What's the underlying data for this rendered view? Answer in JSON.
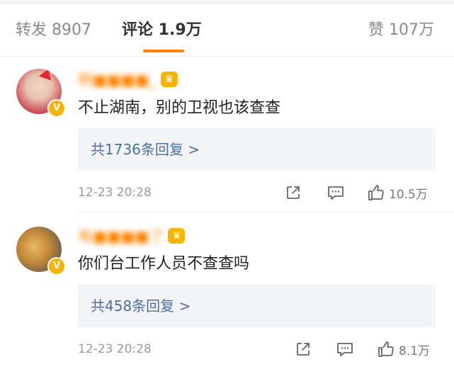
{
  "tabs": {
    "repost": "转发 8907",
    "comments": "评论 1.9万",
    "likes": "赞 107万"
  },
  "colors": {
    "accent": "#ff8200",
    "username": "#ff8200",
    "link": "#4d6e9e",
    "verified": "#f5b400"
  },
  "comments": [
    {
      "username": "杨■■■■_",
      "text": "不止湖南，别的卫视也该查查",
      "replies": "共1736条回复 >",
      "time": "12-23 20:28",
      "likes": "10.5万",
      "icons": [
        "avatar",
        "verified-icon",
        "crown-icon",
        "share-icon",
        "reply-icon",
        "like-icon"
      ]
    },
    {
      "username": "有■■■■了",
      "text": "你们台工作人员不查查吗",
      "replies": "共458条回复 >",
      "time": "12-23 20:28",
      "likes": "8.1万",
      "icons": [
        "avatar",
        "verified-icon",
        "crown-icon",
        "share-icon",
        "reply-icon",
        "like-icon"
      ]
    }
  ]
}
